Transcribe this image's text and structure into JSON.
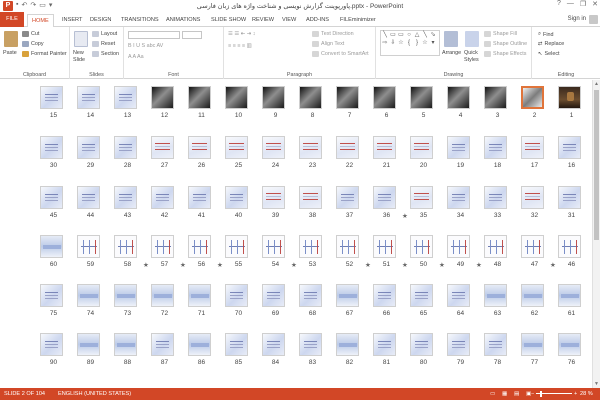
{
  "titlebar": {
    "app_icon": "P",
    "qat": [
      "save-icon",
      "undo-icon",
      "redo-icon",
      "start-slideshow-icon",
      "customize-icon"
    ],
    "title": "پاورپوینت گزارش نویسی و شناخت واژه های زبان فارسی.pptx - PowerPoint",
    "controls": [
      "?",
      "—",
      "❐",
      "✕"
    ]
  },
  "tabs": {
    "file": "FILE",
    "items": [
      "HOME",
      "INSERT",
      "DESIGN",
      "TRANSITIONS",
      "ANIMATIONS",
      "SLIDE SHOW",
      "REVIEW",
      "VIEW",
      "ADD-INS",
      "FILEminimizer"
    ],
    "active": "HOME",
    "signin": "Sign in"
  },
  "ribbon": {
    "clipboard": {
      "label": "Clipboard",
      "paste": "Paste",
      "cut": "Cut",
      "copy": "Copy",
      "format_painter": "Format Painter"
    },
    "slides": {
      "label": "Slides",
      "new_slide": "New",
      "new_slide2": "Slide",
      "layout": "Layout",
      "reset": "Reset",
      "section": "Section"
    },
    "font": {
      "label": "Font"
    },
    "paragraph": {
      "label": "Paragraph",
      "text_direction": "Text Direction",
      "align_text": "Align Text",
      "convert": "Convert to SmartArt"
    },
    "drawing": {
      "label": "Drawing",
      "arrange": "Arrange",
      "quick_styles": "Quick",
      "quick_styles2": "Styles",
      "shape_fill": "Shape Fill",
      "shape_outline": "Shape Outline",
      "shape_effects": "Shape Effects"
    },
    "editing": {
      "label": "Editing",
      "find": "Find",
      "replace": "Replace",
      "select": "Select"
    }
  },
  "slides": {
    "rows": [
      {
        "numbers": [
          "15",
          "14",
          "13",
          "12",
          "11",
          "10",
          "9",
          "8",
          "7",
          "6",
          "5",
          "4",
          "3",
          "2",
          "1"
        ],
        "styles": [
          "blue",
          "blue",
          "blue",
          "dark",
          "dark",
          "dark",
          "dark",
          "dark",
          "dark",
          "dark",
          "dark",
          "dark",
          "dark",
          "steel",
          "img"
        ],
        "stars": []
      },
      {
        "numbers": [
          "30",
          "29",
          "28",
          "27",
          "26",
          "25",
          "24",
          "23",
          "22",
          "21",
          "20",
          "19",
          "18",
          "17",
          "16"
        ],
        "styles": [
          "blue",
          "blue",
          "blue",
          "red",
          "red",
          "red",
          "red",
          "red",
          "red",
          "red",
          "red",
          "blue",
          "blue",
          "red",
          "blue"
        ],
        "stars": []
      },
      {
        "numbers": [
          "45",
          "44",
          "43",
          "42",
          "41",
          "40",
          "39",
          "38",
          "37",
          "36",
          "35",
          "34",
          "33",
          "32",
          "31"
        ],
        "styles": [
          "blue",
          "blue",
          "blue",
          "blue",
          "blue",
          "blue",
          "red",
          "red",
          "blue",
          "blue",
          "red",
          "blue",
          "blue",
          "red",
          "blue"
        ],
        "stars": [
          "35"
        ]
      },
      {
        "numbers": [
          "60",
          "59",
          "58",
          "57",
          "56",
          "55",
          "54",
          "53",
          "52",
          "51",
          "50",
          "49",
          "48",
          "47",
          "46"
        ],
        "styles": [
          "wide",
          "diag",
          "diag",
          "diag",
          "diag",
          "diag",
          "diag",
          "diag",
          "diag",
          "diag",
          "diag",
          "diag",
          "diag",
          "diag",
          "diag"
        ],
        "stars": [
          "57",
          "56",
          "55",
          "53",
          "51",
          "50",
          "49",
          "48",
          "46"
        ]
      },
      {
        "numbers": [
          "75",
          "74",
          "73",
          "72",
          "71",
          "70",
          "69",
          "68",
          "67",
          "66",
          "65",
          "64",
          "63",
          "62",
          "61"
        ],
        "styles": [
          "blue",
          "wide",
          "wide",
          "wide",
          "wide",
          "blue",
          "blue",
          "blue",
          "wide",
          "blue",
          "blue",
          "blue",
          "wide",
          "wide",
          "wide"
        ],
        "stars": []
      },
      {
        "numbers": [
          "90",
          "89",
          "88",
          "87",
          "86",
          "85",
          "84",
          "83",
          "82",
          "81",
          "80",
          "79",
          "78",
          "77",
          "76"
        ],
        "styles": [
          "blue",
          "wide",
          "wide",
          "blue",
          "wide",
          "blue",
          "blue",
          "blue",
          "wide",
          "blue",
          "blue",
          "blue",
          "blue",
          "wide",
          "wide"
        ],
        "stars": []
      }
    ],
    "selected": "2"
  },
  "statusbar": {
    "slide_info": "SLIDE 2 OF 104",
    "language": "ENGLISH (UNITED STATES)",
    "zoom": "28 %",
    "zoom_minus": "−",
    "zoom_plus": "+"
  },
  "colors": {
    "accent": "#d24726",
    "selection": "#e0743a"
  }
}
